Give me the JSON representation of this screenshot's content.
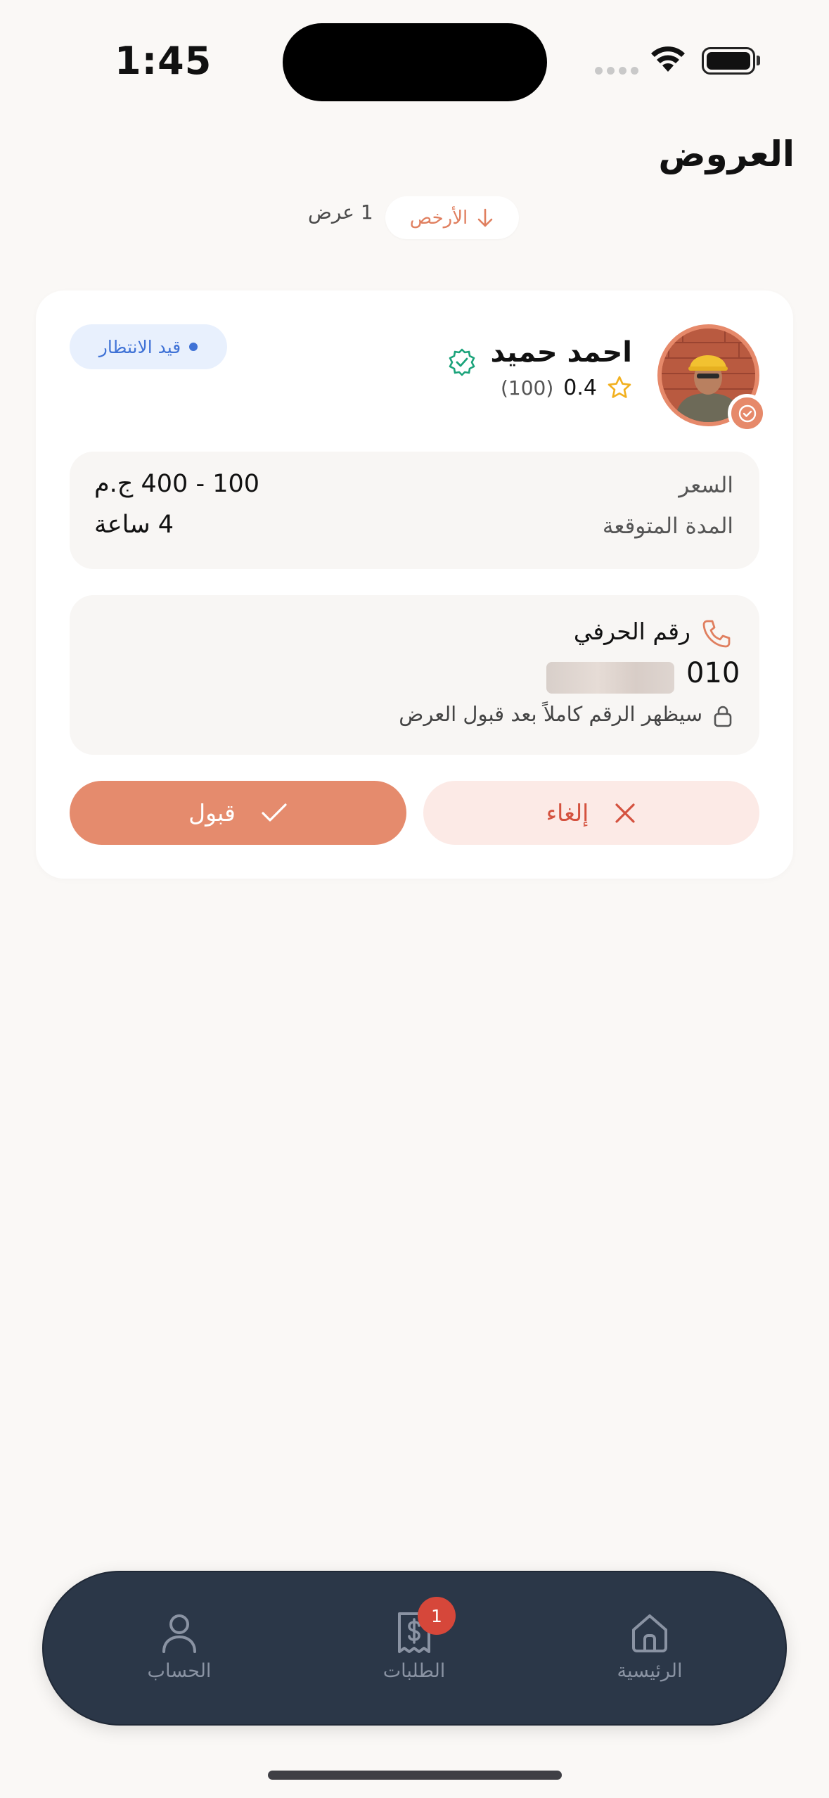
{
  "status_bar": {
    "time": "1:45"
  },
  "header": {
    "title": "العروض",
    "sort_label": "الأرخص",
    "offer_count": "1 عرض"
  },
  "offer": {
    "name": "احمد حميد",
    "rating": "0.4",
    "reviews": "(100)",
    "status": "قيد الانتظار",
    "price_label": "السعر",
    "price_value": "100 - 400 ج.م",
    "duration_label": "المدة المتوقعة",
    "duration_value": "4 ساعة",
    "phone_title": "رقم الحرفي",
    "phone_prefix": "010",
    "phone_note": "سيظهر الرقم كاملاً بعد قبول العرض",
    "accept_label": "قبول",
    "cancel_label": "إلغاء"
  },
  "tabbar": {
    "items": [
      {
        "label": "الرئيسية",
        "icon": "home-icon"
      },
      {
        "label": "الطلبات",
        "icon": "receipt-dollar-icon",
        "badge": "1"
      },
      {
        "label": "الحساب",
        "icon": "user-icon"
      }
    ]
  },
  "colors": {
    "accent": "#e58b6d",
    "cancel_bg": "#fceae6",
    "cancel_text": "#d4523f",
    "status_blue": "#3f72d6",
    "verified_green": "#1aa37a",
    "tabbar_bg": "#2b3748",
    "badge_red": "#d6473a",
    "star": "#f2b01e"
  }
}
